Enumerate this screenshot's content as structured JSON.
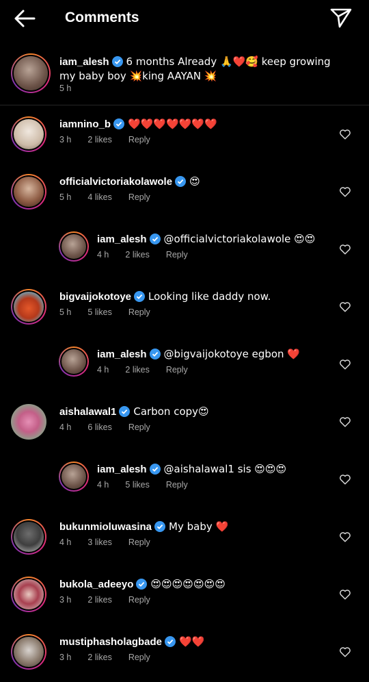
{
  "header": {
    "title": "Comments"
  },
  "caption": {
    "username": "iam_alesh",
    "text": "6 months Already 🙏❤️🥰 keep growing my baby boy 💥king AAYAN 💥",
    "time": "5 h"
  },
  "comments": [
    {
      "username": "iamnino_b",
      "text": "❤️❤️❤️❤️❤️❤️❤️",
      "time": "3 h",
      "likes": "2 likes",
      "reply": "Reply"
    },
    {
      "username": "officialvictoriakolawole",
      "text": "😍",
      "time": "5 h",
      "likes": "4 likes",
      "reply": "Reply"
    },
    {
      "username": "iam_alesh",
      "text": "@officialvictoriakolawole 😍😍",
      "time": "4 h",
      "likes": "2 likes",
      "reply": "Reply"
    },
    {
      "username": "bigvaijokotoye",
      "text": "Looking like daddy now.",
      "time": "5 h",
      "likes": "5 likes",
      "reply": "Reply"
    },
    {
      "username": "iam_alesh",
      "text": "@bigvaijokotoye egbon ❤️",
      "time": "4 h",
      "likes": "2 likes",
      "reply": "Reply"
    },
    {
      "username": "aishalawal1",
      "text": "Carbon copy😍",
      "time": "4 h",
      "likes": "6 likes",
      "reply": "Reply"
    },
    {
      "username": "iam_alesh",
      "text": "@aishalawal1 sis 😍😍😍",
      "time": "4 h",
      "likes": "5 likes",
      "reply": "Reply"
    },
    {
      "username": "bukunmioluwasina",
      "text": "My baby ❤️",
      "time": "4 h",
      "likes": "3 likes",
      "reply": "Reply"
    },
    {
      "username": "bukola_adeeyo",
      "text": "😍😍😍😍😍😍😍",
      "time": "3 h",
      "likes": "2 likes",
      "reply": "Reply"
    },
    {
      "username": "mustiphasholagbade",
      "text": "❤️❤️",
      "time": "3 h",
      "likes": "2 likes",
      "reply": "Reply"
    }
  ],
  "icons": {
    "back": "back-arrow-icon",
    "send": "send-icon",
    "heart": "heart-outline-icon",
    "verified": "verified-badge-icon"
  },
  "colors": {
    "background": "#000000",
    "verified": "#3897f0",
    "meta": "#a8a8a8"
  }
}
